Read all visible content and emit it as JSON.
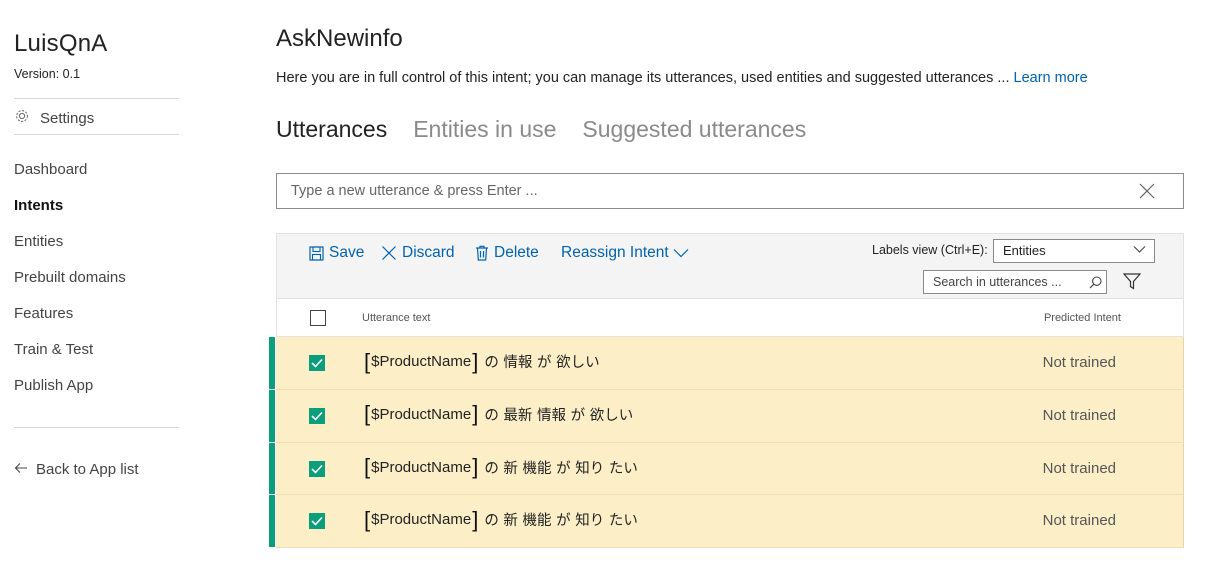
{
  "sidebar": {
    "app_name": "LuisQnA",
    "version_label": "Version:",
    "version_value": "0.1",
    "settings_label": "Settings",
    "nav": [
      "Dashboard",
      "Intents",
      "Entities",
      "Prebuilt domains",
      "Features",
      "Train & Test",
      "Publish App"
    ],
    "active_nav": "Intents",
    "back_label": "Back to App list"
  },
  "main": {
    "title": "AskNewinfo",
    "description": "Here you are in full control of this intent; you can manage its utterances, used entities and suggested utterances ...",
    "learn_more": "Learn more",
    "tabs": [
      "Utterances",
      "Entities in use",
      "Suggested utterances"
    ],
    "active_tab": "Utterances",
    "utterance_input_placeholder": "Type a new utterance & press Enter ...",
    "toolbar": {
      "save": "Save",
      "discard": "Discard",
      "delete": "Delete",
      "reassign": "Reassign Intent",
      "labels_view": "Labels view (Ctrl+E):",
      "labels_view_value": "Entities",
      "search_placeholder": "Search in utterances ..."
    },
    "columns": {
      "utterance": "Utterance text",
      "predicted": "Predicted Intent"
    },
    "rows": [
      {
        "entity": "$ProductName",
        "rest": "の 情報 が 欲しい",
        "predicted": "Not trained",
        "checked": true
      },
      {
        "entity": "$ProductName",
        "rest": "の 最新 情報 が 欲しい",
        "predicted": "Not trained",
        "checked": true
      },
      {
        "entity": "$ProductName",
        "rest": "の 新 機能 が 知り たい",
        "predicted": "Not trained",
        "checked": true
      },
      {
        "entity": "$ProductName",
        "rest": "の 新 機能 が 知り たい",
        "predicted": "Not trained",
        "checked": true
      }
    ]
  },
  "colors": {
    "accent_link": "#0063b1",
    "row_highlight": "#fcefc8",
    "check_green": "#0a9e7b"
  },
  "icons": {
    "settings": "gear-icon",
    "back": "arrow-left-icon",
    "clear": "close-icon",
    "save": "save-icon",
    "discard": "close-icon",
    "delete": "trash-icon",
    "reassign": "chevron-down-icon",
    "search": "search-icon",
    "filter": "filter-icon",
    "checkbox": "checkmark-icon"
  }
}
